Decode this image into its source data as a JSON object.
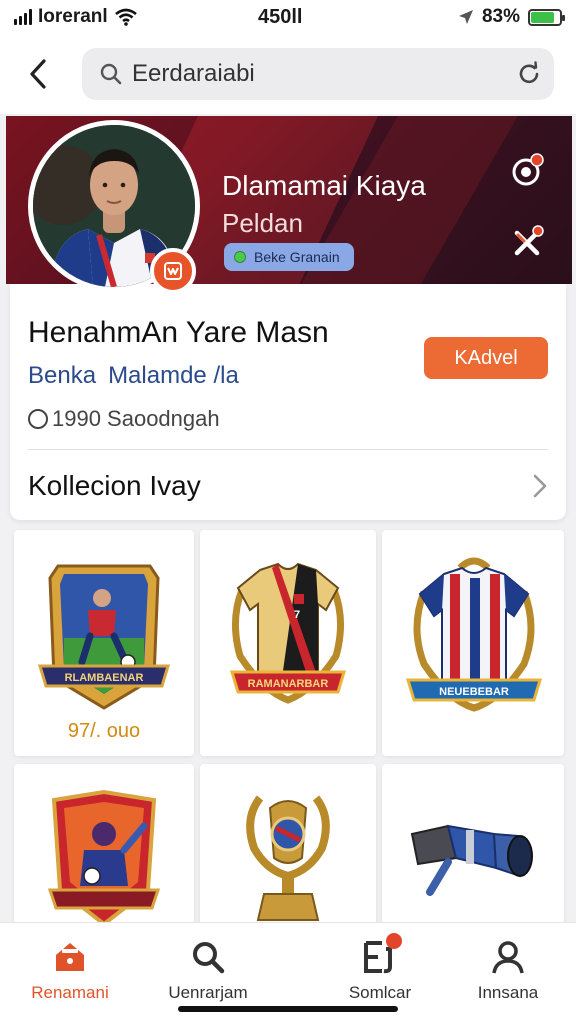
{
  "status_bar": {
    "carrier": "Ioreranl",
    "time": "450ll",
    "battery": "83%",
    "battery_level": 0.83
  },
  "header": {
    "back_icon": "chevron-left-icon",
    "search_value": "Eerdaraiabi",
    "search_icon": "search-icon",
    "refresh_icon": "refresh-icon"
  },
  "profile": {
    "name": "Dlamamai Kiaya",
    "subtitle": "Peldan",
    "status_chip": "Beke Granain",
    "status_color": "#4ec94e"
  },
  "info": {
    "title": "HenahmAn Yare Masn",
    "subtitle_a": "Benka",
    "subtitle_b": "Malamde /la",
    "meta": "1990 Saoodngah",
    "follow_button": "KAdvel",
    "collection_label": "Kollecion Ivay"
  },
  "grid": {
    "items": [
      {
        "name": "player-card",
        "caption": "RLAMBAENAR",
        "price": "97/. ouo"
      },
      {
        "name": "jersey-gold-black",
        "caption": "RAMANARBAR",
        "price": ""
      },
      {
        "name": "jersey-stripes",
        "caption": "NEUEBEBAR",
        "price": ""
      },
      {
        "name": "hero-card",
        "caption": "",
        "price": ""
      },
      {
        "name": "trophy",
        "caption": "",
        "price": ""
      },
      {
        "name": "telescope",
        "caption": "",
        "price": ""
      }
    ]
  },
  "tabbar": {
    "tabs": [
      {
        "label": "Renamani",
        "icon": "home-icon",
        "active": true
      },
      {
        "label": "Uenrarjam",
        "icon": "search-icon",
        "active": false
      },
      {
        "label": "Somlcar",
        "icon": "collection-icon",
        "active": false,
        "badge": true
      },
      {
        "label": "Innsana",
        "icon": "profile-icon",
        "active": false
      }
    ]
  },
  "colors": {
    "accent": "#ec6a34",
    "banner": "#5c1220",
    "price": "#d28a12"
  }
}
